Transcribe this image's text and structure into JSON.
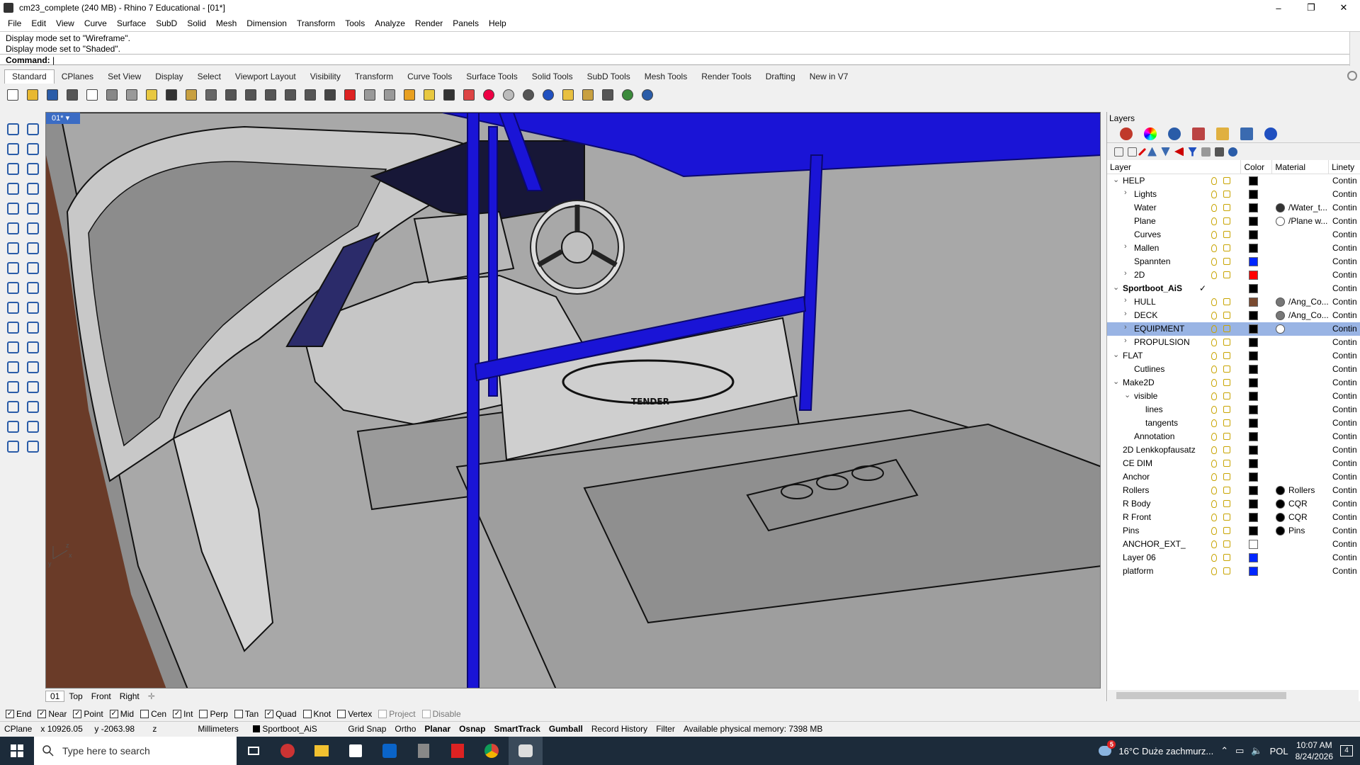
{
  "window": {
    "title": "cm23_complete (240 MB) - Rhino 7 Educational - [01*]",
    "controls": [
      "–",
      "❐",
      "✕"
    ]
  },
  "menu": [
    "File",
    "Edit",
    "View",
    "Curve",
    "Surface",
    "SubD",
    "Solid",
    "Mesh",
    "Dimension",
    "Transform",
    "Tools",
    "Analyze",
    "Render",
    "Panels",
    "Help"
  ],
  "command": {
    "history": [
      "Display mode set to \"Wireframe\".",
      "Display mode set to \"Shaded\"."
    ],
    "prompt": "Command:"
  },
  "toolbar_tabs": [
    "Standard",
    "CPlanes",
    "Set View",
    "Display",
    "Select",
    "Viewport Layout",
    "Visibility",
    "Transform",
    "Curve Tools",
    "Surface Tools",
    "Solid Tools",
    "SubD Tools",
    "Mesh Tools",
    "Render Tools",
    "Drafting",
    "New in V7"
  ],
  "toolbar_icons": [
    "new-icon",
    "open-icon",
    "save-icon",
    "print-icon",
    "export-icon",
    "cut-icon",
    "copy-icon",
    "paste-icon",
    "undo-icon",
    "pan-icon",
    "rotate-icon",
    "zoom-icon",
    "zoom-window-icon",
    "zoom-extents-icon",
    "zoom-selected-icon",
    "zoom-dynamic-icon",
    "grid-icon",
    "car-icon",
    "render-icon",
    "circle-icon",
    "points-icon",
    "bulb-icon",
    "lock-icon",
    "material-icon",
    "color-wheel-icon",
    "sphere-icon",
    "shaded-sphere-icon",
    "blue-sphere-icon",
    "select-icon",
    "gear-settings-icon",
    "dimension-icon",
    "globe-icon",
    "help-icon"
  ],
  "viewport": {
    "name": "01*",
    "tabs": [
      "01",
      "Top",
      "Front",
      "Right"
    ],
    "add_tab": "✛",
    "axis": {
      "x": "x",
      "y": "y",
      "z": "z"
    },
    "logo_text": "TENDER"
  },
  "layers_panel": {
    "title": "Layers",
    "headers": {
      "layer": "Layer",
      "color": "Color",
      "material": "Material",
      "linetype": "Linety"
    },
    "rows": [
      {
        "name": "HELP",
        "indent": 0,
        "twisty": "⌄",
        "color": "#000000",
        "mat": "",
        "lt": "Contin"
      },
      {
        "name": "Lights",
        "indent": 1,
        "twisty": "›",
        "color": "#000000",
        "mat": "",
        "lt": "Contin"
      },
      {
        "name": "Water",
        "indent": 1,
        "twisty": "",
        "color": "#000000",
        "mat": "/Water_t...",
        "matcolor": "#333333",
        "lt": "Contin"
      },
      {
        "name": "Plane",
        "indent": 1,
        "twisty": "",
        "color": "#000000",
        "mat": "/Plane w...",
        "matcolor": "#ffffff",
        "lt": "Contin"
      },
      {
        "name": "Curves",
        "indent": 1,
        "twisty": "",
        "color": "#000000",
        "mat": "",
        "lt": "Contin"
      },
      {
        "name": "Mallen",
        "indent": 1,
        "twisty": "›",
        "color": "#000000",
        "mat": "",
        "lt": "Contin"
      },
      {
        "name": "Spannten",
        "indent": 1,
        "twisty": "",
        "color": "#0026ff",
        "mat": "",
        "lt": "Contin"
      },
      {
        "name": "2D",
        "indent": 1,
        "twisty": "›",
        "color": "#ff0000",
        "mat": "",
        "lt": "Contin"
      },
      {
        "name": "Sportboot_AiS",
        "indent": 0,
        "twisty": "⌄",
        "color": "#000000",
        "mat": "",
        "lt": "Contin",
        "bold": true,
        "current": "✓"
      },
      {
        "name": "HULL",
        "indent": 1,
        "twisty": "›",
        "color": "#7a4a30",
        "mat": "/Ang_Co...",
        "matcolor": "#777777",
        "lt": "Contin"
      },
      {
        "name": "DECK",
        "indent": 1,
        "twisty": "›",
        "color": "#000000",
        "mat": "/Ang_Co...",
        "matcolor": "#777777",
        "lt": "Contin"
      },
      {
        "name": "EQUIPMENT",
        "indent": 1,
        "twisty": "›",
        "color": "#000000",
        "mat": "",
        "matcolor": "#ffffff",
        "lt": "Contin",
        "selected": true
      },
      {
        "name": "PROPULSION",
        "indent": 1,
        "twisty": "›",
        "color": "#000000",
        "mat": "",
        "lt": "Contin"
      },
      {
        "name": "FLAT",
        "indent": 0,
        "twisty": "⌄",
        "color": "#000000",
        "mat": "",
        "lt": "Contin"
      },
      {
        "name": "Cutlines",
        "indent": 1,
        "twisty": "",
        "color": "#000000",
        "mat": "",
        "lt": "Contin"
      },
      {
        "name": "Make2D",
        "indent": 0,
        "twisty": "⌄",
        "color": "#000000",
        "mat": "",
        "lt": "Contin"
      },
      {
        "name": "visible",
        "indent": 1,
        "twisty": "⌄",
        "color": "#000000",
        "mat": "",
        "lt": "Contin"
      },
      {
        "name": "lines",
        "indent": 2,
        "twisty": "",
        "color": "#000000",
        "mat": "",
        "lt": "Contin"
      },
      {
        "name": "tangents",
        "indent": 2,
        "twisty": "",
        "color": "#000000",
        "mat": "",
        "lt": "Contin"
      },
      {
        "name": "Annotation",
        "indent": 1,
        "twisty": "",
        "color": "#000000",
        "mat": "",
        "lt": "Contin"
      },
      {
        "name": "2D Lenkkopfausatz",
        "indent": 0,
        "twisty": "",
        "color": "#000000",
        "mat": "",
        "lt": "Contin"
      },
      {
        "name": "CE DIM",
        "indent": 0,
        "twisty": "",
        "color": "#000000",
        "mat": "",
        "lt": "Contin"
      },
      {
        "name": "Anchor",
        "indent": 0,
        "twisty": "",
        "color": "#000000",
        "mat": "",
        "lt": "Contin"
      },
      {
        "name": "Rollers",
        "indent": 0,
        "twisty": "",
        "color": "#000000",
        "mat": "Rollers",
        "matcolor": "#000000",
        "lt": "Contin"
      },
      {
        "name": "R Body",
        "indent": 0,
        "twisty": "",
        "color": "#000000",
        "mat": "CQR",
        "matcolor": "#000000",
        "lt": "Contin"
      },
      {
        "name": "R Front",
        "indent": 0,
        "twisty": "",
        "color": "#000000",
        "mat": "CQR",
        "matcolor": "#000000",
        "lt": "Contin"
      },
      {
        "name": "Pins",
        "indent": 0,
        "twisty": "",
        "color": "#000000",
        "mat": "Pins",
        "matcolor": "#000000",
        "lt": "Contin"
      },
      {
        "name": "ANCHOR_EXT_",
        "indent": 0,
        "twisty": "",
        "color": "#ffffff",
        "mat": "",
        "lt": "Contin"
      },
      {
        "name": "Layer 06",
        "indent": 0,
        "twisty": "",
        "color": "#0026ff",
        "mat": "",
        "lt": "Contin"
      },
      {
        "name": "platform",
        "indent": 0,
        "twisty": "",
        "color": "#0026ff",
        "mat": "",
        "lt": "Contin"
      }
    ]
  },
  "osnap": [
    {
      "label": "End",
      "checked": true
    },
    {
      "label": "Near",
      "checked": true
    },
    {
      "label": "Point",
      "checked": true
    },
    {
      "label": "Mid",
      "checked": true
    },
    {
      "label": "Cen",
      "checked": false
    },
    {
      "label": "Int",
      "checked": true
    },
    {
      "label": "Perp",
      "checked": false
    },
    {
      "label": "Tan",
      "checked": false
    },
    {
      "label": "Quad",
      "checked": true
    },
    {
      "label": "Knot",
      "checked": false
    },
    {
      "label": "Vertex",
      "checked": false
    },
    {
      "label": "Project",
      "checked": false,
      "disabled": true
    },
    {
      "label": "Disable",
      "checked": false,
      "disabled": true
    }
  ],
  "status": {
    "cplane": "CPlane",
    "x": "x 10926.05",
    "y": "y -2063.98",
    "z": "z",
    "units": "Millimeters",
    "layer": "Sportboot_AiS",
    "grid_snap": "Grid Snap",
    "ortho": "Ortho",
    "planar": "Planar",
    "osnap": "Osnap",
    "smarttrack": "SmartTrack",
    "gumball": "Gumball",
    "record_history": "Record History",
    "filter": "Filter",
    "memory": "Available physical memory: 7398 MB"
  },
  "taskbar": {
    "search_placeholder": "Type here to search",
    "weather": "16°C  Duże zachmurz...",
    "lang": "POL",
    "time": "10:07 AM",
    "date": "8/24/2026",
    "notif_count": "4",
    "weather_badge": "5"
  },
  "colors": {
    "accent": "#3b6cc4",
    "selection": "#99b4e4",
    "boat_blue": "#1a14d6",
    "taskbar": "#1c2b3a"
  }
}
